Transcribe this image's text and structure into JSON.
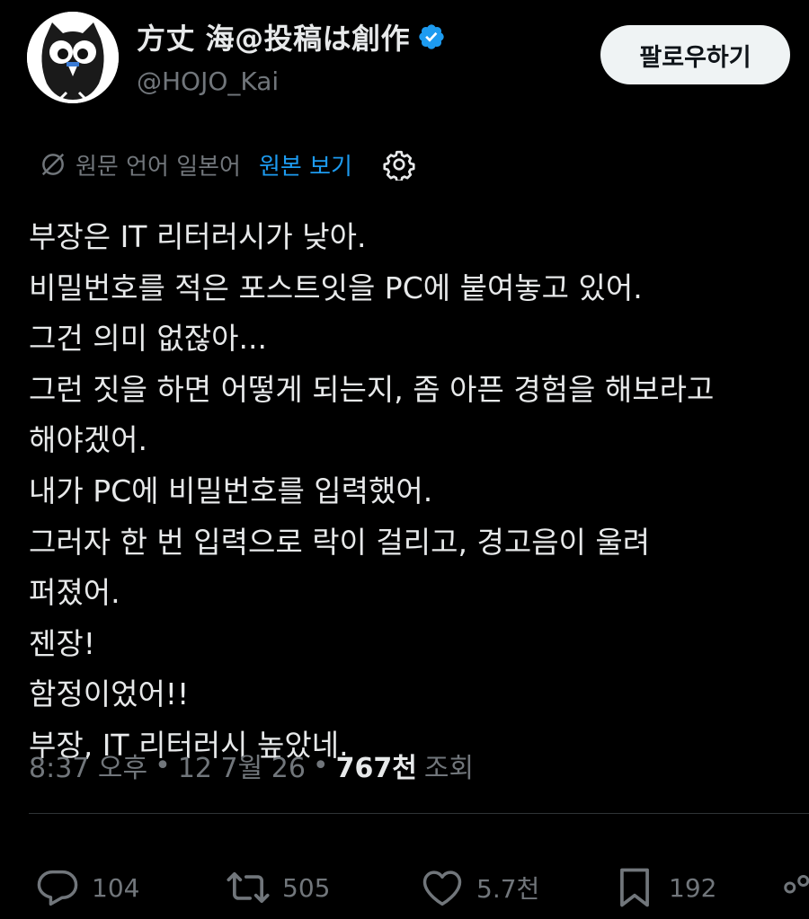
{
  "author": {
    "display_name": "方丈 海@投稿は創作",
    "handle": "@HOJO_Kai"
  },
  "follow_button": {
    "label": "팔로우하기"
  },
  "translation": {
    "source_language_text": "원문 언어 일본어",
    "show_original_label": "원본 보기"
  },
  "tweet": {
    "lines": [
      "부장은 IT 리터러시가 낮아.",
      "비밀번호를 적은 포스트잇을 PC에 붙여놓고 있어.",
      "그건 의미 없잖아...",
      "그런 짓을 하면 어떻게 되는지, 좀 아픈 경험을 해보라고",
      "해야겠어.",
      "내가 PC에 비밀번호를 입력했어.",
      "그러자 한 번 입력으로 락이 걸리고, 경고음이 울려",
      "퍼졌어.",
      "젠장!",
      "함정이었어!!",
      "부장, IT 리터러시 높았네."
    ]
  },
  "meta": {
    "time": "8:37 오후",
    "separator": "•",
    "date": "12 7월 26",
    "views_count": "767천",
    "views_label": "조회"
  },
  "actions": {
    "reply_count": "104",
    "retweet_count": "505",
    "like_count": "5.7천",
    "bookmark_count": "192"
  },
  "colors": {
    "background": "#000000",
    "text": "#e7e9ea",
    "muted": "#71767b",
    "accent": "#1d9bf0",
    "divider": "#2f3336"
  },
  "icons": [
    "owl-avatar",
    "verified-badge-icon",
    "globe-slash-icon",
    "gear-icon",
    "reply-icon",
    "retweet-icon",
    "heart-icon",
    "bookmark-icon",
    "share-icon"
  ]
}
